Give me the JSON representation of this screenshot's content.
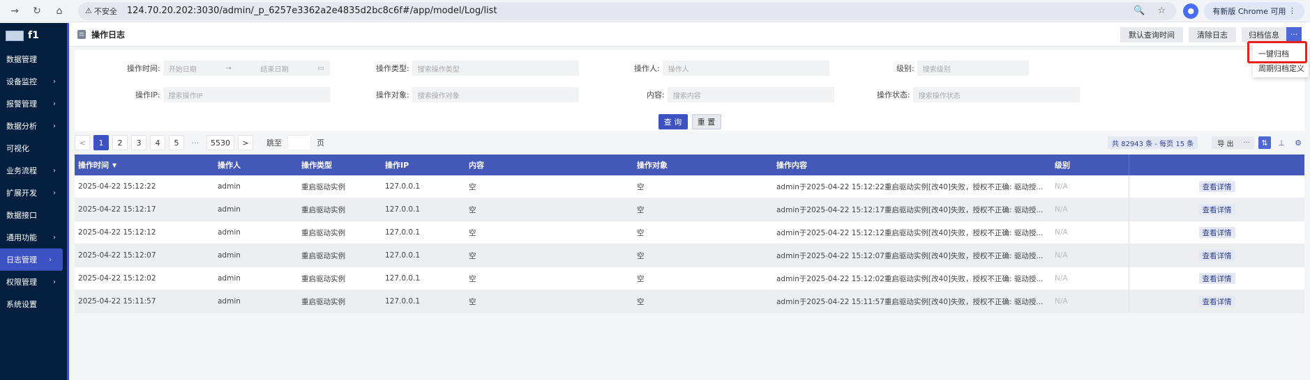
{
  "browser": {
    "warning": "不安全",
    "url": "124.70.20.202:3030/admin/_p_6257e3362a2e4835d2bc8c6f#/app/model/Log/list",
    "update_label": "有新版 Chrome 可用"
  },
  "app": {
    "name": "f1"
  },
  "sidebar": {
    "items": [
      {
        "label": "数据管理",
        "chevron": false
      },
      {
        "label": "设备监控",
        "chevron": true
      },
      {
        "label": "报警管理",
        "chevron": true
      },
      {
        "label": "数据分析",
        "chevron": true
      },
      {
        "label": "可视化",
        "chevron": false
      },
      {
        "label": "业务流程",
        "chevron": true
      },
      {
        "label": "扩展开发",
        "chevron": true
      },
      {
        "label": "数据接口",
        "chevron": false
      },
      {
        "label": "通用功能",
        "chevron": true
      },
      {
        "label": "日志管理",
        "chevron": true,
        "active": true
      },
      {
        "label": "权限管理",
        "chevron": true
      },
      {
        "label": "系统设置",
        "chevron": false
      }
    ]
  },
  "header": {
    "title": "操作日志",
    "btn_default_time": "默认查询时间",
    "btn_clear": "清除日志",
    "btn_archive_info": "归档信息",
    "btn_more": "···"
  },
  "dropdown": {
    "items": [
      "一键归档",
      "周期归档定义"
    ]
  },
  "filters": {
    "time_label": "操作时间:",
    "start_placeholder": "开始日期",
    "arrow": "→",
    "end_placeholder": "结束日期",
    "type_label": "操作类型:",
    "type_placeholder": "搜索操作类型",
    "user_label": "操作人:",
    "user_placeholder": "操作人",
    "level_label": "级别:",
    "level_placeholder": "搜索级别",
    "ip_label": "操作IP:",
    "ip_placeholder": "搜索操作IP",
    "target_label": "操作对象:",
    "target_placeholder": "搜索操作对象",
    "content_label": "内容:",
    "content_placeholder": "搜索内容",
    "status_label": "操作状态:",
    "status_placeholder": "搜索操作状态",
    "query": "查 询",
    "reset": "重 置"
  },
  "pager": {
    "prev": "<",
    "pages": [
      "1",
      "2",
      "3",
      "4",
      "5"
    ],
    "ellipsis": "···",
    "last": "5530",
    "next": ">",
    "goto_label": "跳至",
    "page_suffix": "页",
    "total": "共 82943 条 - 每页 15 条",
    "export": "导 出",
    "export_more": "···"
  },
  "table": {
    "columns": [
      "操作时间",
      "操作人",
      "操作类型",
      "操作IP",
      "内容",
      "操作对象",
      "操作内容",
      "级别",
      ""
    ],
    "rows": [
      {
        "time": "2025-04-22 15:12:22",
        "user": "admin",
        "type": "重启驱动实例",
        "ip": "127.0.0.1",
        "content": "空",
        "target": "空",
        "detail": "admin于2025-04-22 15:12:22重启驱动实例[改40]失败，授权不正确: 驱动授...",
        "level": "N/A",
        "action": "查看详情"
      },
      {
        "time": "2025-04-22 15:12:17",
        "user": "admin",
        "type": "重启驱动实例",
        "ip": "127.0.0.1",
        "content": "空",
        "target": "空",
        "detail": "admin于2025-04-22 15:12:17重启驱动实例[改40]失败，授权不正确: 驱动授...",
        "level": "N/A",
        "action": "查看详情"
      },
      {
        "time": "2025-04-22 15:12:12",
        "user": "admin",
        "type": "重启驱动实例",
        "ip": "127.0.0.1",
        "content": "空",
        "target": "空",
        "detail": "admin于2025-04-22 15:12:12重启驱动实例[改40]失败，授权不正确: 驱动授...",
        "level": "N/A",
        "action": "查看详情"
      },
      {
        "time": "2025-04-22 15:12:07",
        "user": "admin",
        "type": "重启驱动实例",
        "ip": "127.0.0.1",
        "content": "空",
        "target": "空",
        "detail": "admin于2025-04-22 15:12:07重启驱动实例[改40]失败，授权不正确: 驱动授...",
        "level": "N/A",
        "action": "查看详情"
      },
      {
        "time": "2025-04-22 15:12:02",
        "user": "admin",
        "type": "重启驱动实例",
        "ip": "127.0.0.1",
        "content": "空",
        "target": "空",
        "detail": "admin于2025-04-22 15:12:02重启驱动实例[改40]失败，授权不正确: 驱动授...",
        "level": "N/A",
        "action": "查看详情"
      },
      {
        "time": "2025-04-22 15:11:57",
        "user": "admin",
        "type": "重启驱动实例",
        "ip": "127.0.0.1",
        "content": "空",
        "target": "空",
        "detail": "admin于2025-04-22 15:11:57重启驱动实例[改40]失败，授权不正确: 驱动授...",
        "level": "N/A",
        "action": "查看详情"
      }
    ]
  },
  "colors": {
    "sidebar_bg": "#051f3e",
    "accent": "#3d52c2",
    "table_header": "#4458b8",
    "highlight_box": "#e8201c"
  }
}
